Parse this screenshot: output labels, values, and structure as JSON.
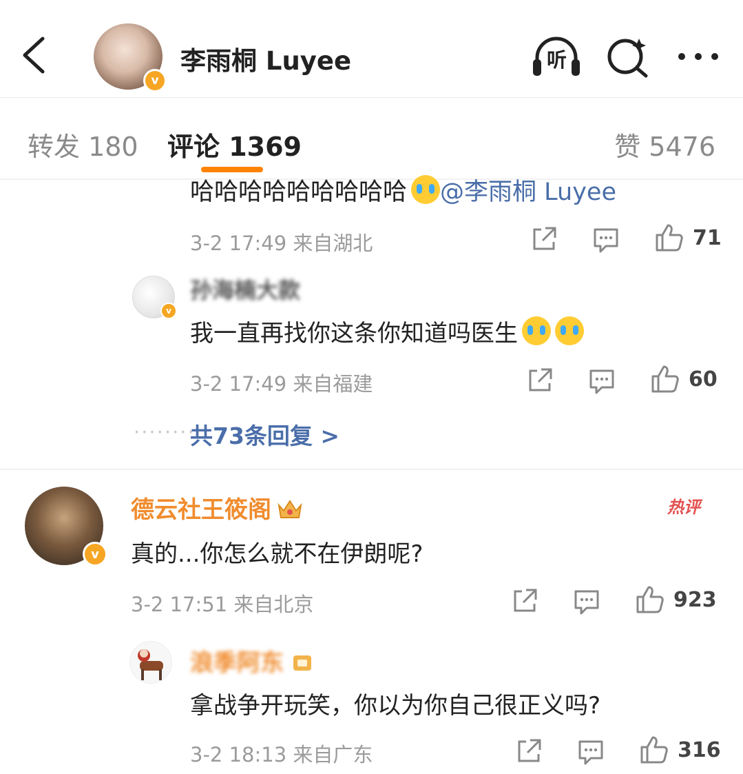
{
  "header": {
    "title": "李雨桐 Luyee",
    "listen_label": "听",
    "icons": [
      "back-arrow-icon",
      "listen-icon",
      "search-icon",
      "more-icon"
    ]
  },
  "tabs": {
    "repost": "转发 180",
    "comment": "评论 1369",
    "like": "赞 5476"
  },
  "replies": {
    "first": {
      "text": "哈哈哈哈哈哈哈哈哈",
      "mention": "@李雨桐 Luyee",
      "date": "3-2 17:49",
      "location": "来自湖北",
      "likes": "71"
    },
    "second": {
      "author": "孙海楠大款",
      "text": "我一直再找你这条你知道吗医生",
      "date": "3-2 17:49",
      "location": "来自福建",
      "likes": "60"
    },
    "more_link": "共73条回复 >"
  },
  "comment": {
    "author": "德云社王筱阁",
    "hot_label": "热评",
    "text": "真的...你怎么就不在伊朗呢?",
    "date": "3-2 17:51",
    "location": "来自北京",
    "likes": "923"
  },
  "subreply": {
    "author": "浪季阿东",
    "text": "拿战争开玩笑，你以为你自己很正义吗?",
    "date": "3-2 18:13",
    "location": "来自广东",
    "likes": "316"
  },
  "colors": {
    "accent": "#ff8200",
    "mention": "#4a6ea9",
    "author_orange": "#f08c2e",
    "hot": "#e3514f",
    "verify": "#f6a623"
  }
}
